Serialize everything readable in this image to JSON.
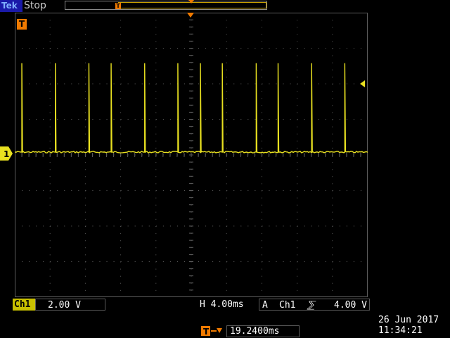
{
  "header": {
    "brand": "Tek",
    "run_state": "Stop"
  },
  "colors": {
    "channel1": "#e8e020",
    "trigger": "#f07a00",
    "grid": "#5c5c5c",
    "brand_bg": "#1a1aa8"
  },
  "screen": {
    "trigger_badge": "T",
    "ground_label": "1"
  },
  "trace": {
    "pulse_times_div": [
      0.2,
      1.15,
      2.1,
      2.73,
      3.68,
      4.62,
      5.26,
      5.88,
      6.84,
      7.46,
      8.41,
      9.35
    ],
    "pulse_height_div": 2.5,
    "baseline_offset_div": 0
  },
  "readouts": {
    "ch1_label": "Ch1",
    "ch1_scale": "2.00 V",
    "horizontal_scale": "H 4.00ms",
    "trigger_mode": "A",
    "trigger_source": "Ch1",
    "trigger_slope": "⅀",
    "trigger_level": "4.00 V",
    "trigger_delay": "19.2400ms",
    "date": "26 Jun  2017",
    "time": "11:34:21"
  }
}
